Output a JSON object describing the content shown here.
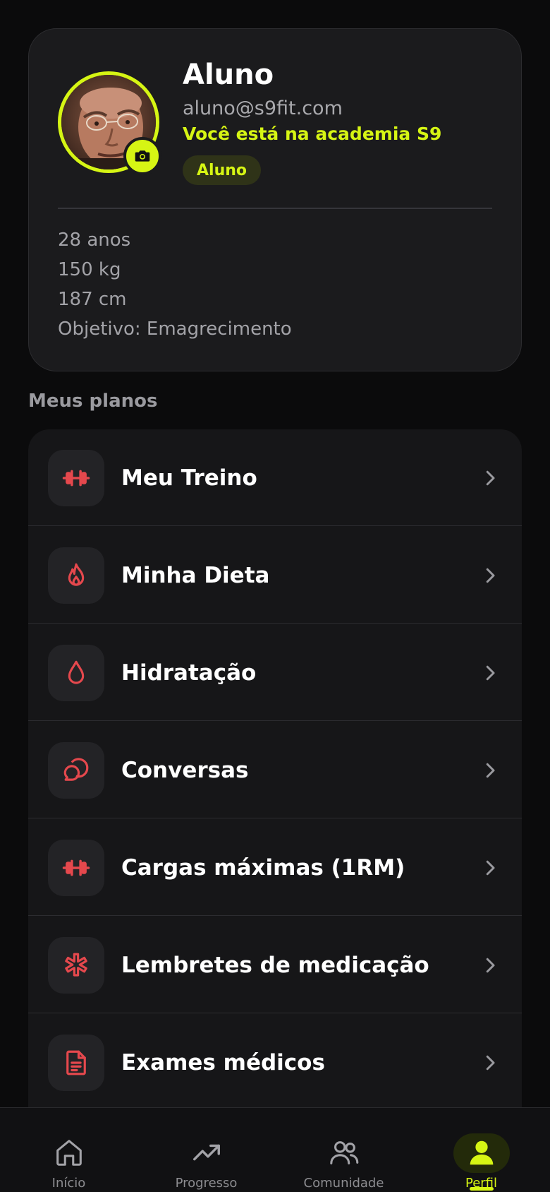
{
  "profile": {
    "name": "Aluno",
    "email": "aluno@s9fit.com",
    "gym_text": "Você está na academia S9",
    "role_badge": "Aluno",
    "stats": [
      "28 anos",
      "150 kg",
      "187 cm",
      "Objetivo: Emagrecimento"
    ],
    "camera_icon": "camera-icon"
  },
  "section": {
    "title": "Meus planos"
  },
  "menu": [
    {
      "label": "Meu Treino",
      "icon": "dumbbell-icon"
    },
    {
      "label": "Minha Dieta",
      "icon": "flame-icon"
    },
    {
      "label": "Hidratação",
      "icon": "droplet-icon"
    },
    {
      "label": "Conversas",
      "icon": "chat-icon"
    },
    {
      "label": "Cargas máximas (1RM)",
      "icon": "dumbbell-icon"
    },
    {
      "label": "Lembretes de medicação",
      "icon": "medical-asterisk-icon"
    },
    {
      "label": "Exames médicos",
      "icon": "document-icon"
    }
  ],
  "bottom_nav": [
    {
      "icon": "home-icon",
      "label": "Início"
    },
    {
      "icon": "trending-up-icon",
      "label": "Progresso"
    },
    {
      "icon": "users-icon",
      "label": "Comunidade"
    },
    {
      "icon": "user-icon",
      "label": "Perfil",
      "active": true
    }
  ],
  "colors": {
    "accent": "#d6f514",
    "icon_red": "#e5484d",
    "background": "#0b0b0c",
    "card": "#1b1b1d"
  }
}
